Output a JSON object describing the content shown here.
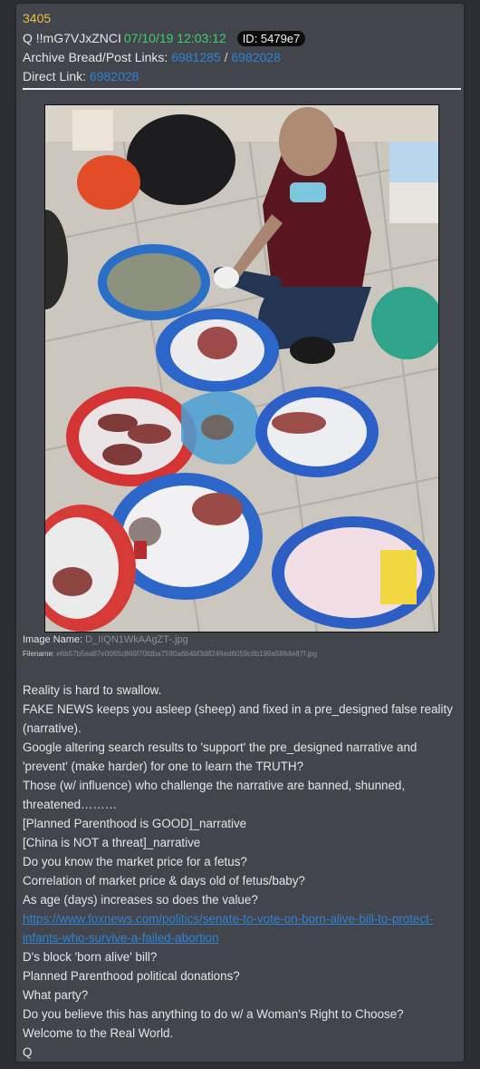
{
  "post": {
    "number": "3405",
    "author": "Q",
    "tripcode": "!!mG7VJxZNCI",
    "timestamp": "07/10/19 12:03:12",
    "id_label": "ID: 5479e7",
    "archive_label": "Archive Bread/Post Links:",
    "archive_link_1": "6981285",
    "archive_sep": "/",
    "archive_link_2": "6982028",
    "direct_label": "Direct Link:",
    "direct_link": "6982028"
  },
  "image": {
    "name_label": "Image Name:",
    "name_value": "D_IIQN1WkAAgZT-.jpg",
    "filename_label": "Filename:",
    "filename_value": "e6b57b5ea87e0065c869f70fdba7590a6b4bf3d8246ed6059c6b199a5864e87f.jpg"
  },
  "body": {
    "lines": [
      "Reality is hard to swallow.",
      "FAKE NEWS keeps you asleep (sheep) and fixed in a pre_designed false reality",
      "(narrative).",
      "Google altering search results to 'support' the pre_designed narrative and",
      "'prevent' (make harder) for one to learn the TRUTH?",
      "Those (w/ influence) who challenge the narrative are banned, shunned,",
      "threatened………",
      "[Planned Parenthood is GOOD]_narrative",
      "[China is NOT a threat]_narrative",
      "Do you know the market price for a fetus?",
      "Correlation of market price & days old of fetus/baby?",
      "As age (days) increases so does the value?"
    ],
    "link_line_1": "https://www.foxnews.com/politics/senate-to-vote-on-born-alive-bill-to-protect-",
    "link_line_2": "infants-who-survive-a-failed-abortion",
    "lines_after": [
      "D's block 'born alive' bill?",
      "Planned Parenthood political donations?",
      "What party?",
      "Do you believe this has anything to do w/ a Woman's Right to Choose?",
      "Welcome to the Real World.",
      "Q"
    ]
  },
  "colors": {
    "page_bg": "#2c2e33",
    "post_bg": "#42454b",
    "post_number": "#e8c23a",
    "timestamp": "#3fcf6d",
    "link": "#2f83d6",
    "id_badge_bg": "#0c0c0d"
  }
}
